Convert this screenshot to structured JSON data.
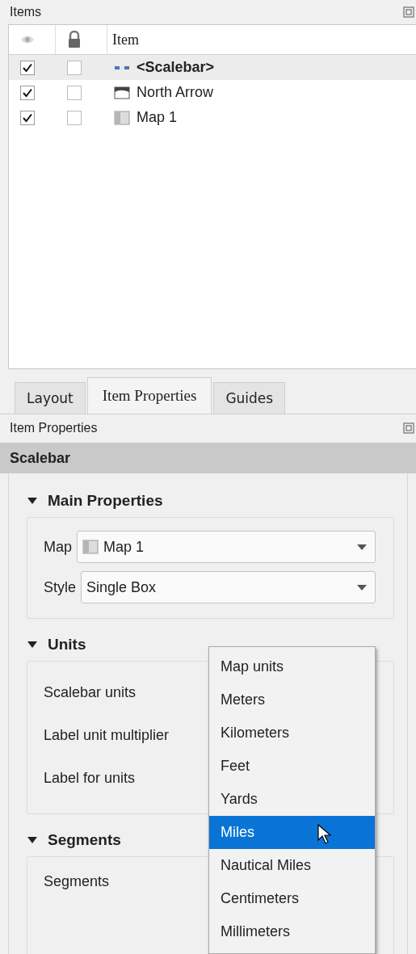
{
  "items_panel": {
    "title": "Items",
    "item_column": "Item",
    "rows": [
      {
        "label": "<Scalebar>",
        "kind": "scalebar",
        "visible": true,
        "locked": false,
        "selected": true
      },
      {
        "label": "North Arrow",
        "kind": "picture",
        "visible": true,
        "locked": false,
        "selected": false
      },
      {
        "label": "Map 1",
        "kind": "map",
        "visible": true,
        "locked": false,
        "selected": false
      }
    ]
  },
  "tabs": [
    {
      "label": "Layout",
      "selected": false
    },
    {
      "label": "Item Properties",
      "selected": true
    },
    {
      "label": "Guides",
      "selected": false
    }
  ],
  "properties_panel": {
    "title": "Item Properties",
    "item_header": "Scalebar",
    "groups": [
      {
        "title": "Main Properties",
        "expanded": true,
        "rows": [
          {
            "label": "Map",
            "kind": "map_combo",
            "value": "Map 1"
          },
          {
            "label": "Style",
            "kind": "combo",
            "value": "Single Box"
          }
        ]
      },
      {
        "title": "Units",
        "expanded": true,
        "rows": [
          {
            "label": "Scalebar units",
            "kind": "label"
          },
          {
            "label": "Label unit multiplier",
            "kind": "label"
          },
          {
            "label": "Label for units",
            "kind": "label"
          }
        ]
      },
      {
        "title": "Segments",
        "expanded": true,
        "rows": [
          {
            "label": "Segments",
            "kind": "label"
          }
        ]
      }
    ]
  },
  "units_dropdown": {
    "options": [
      {
        "label": "Map units",
        "selected": false
      },
      {
        "label": "Meters",
        "selected": false
      },
      {
        "label": "Kilometers",
        "selected": false
      },
      {
        "label": "Feet",
        "selected": false
      },
      {
        "label": "Yards",
        "selected": false
      },
      {
        "label": "Miles",
        "selected": true
      },
      {
        "label": "Nautical Miles",
        "selected": false
      },
      {
        "label": "Centimeters",
        "selected": false
      },
      {
        "label": "Millimeters",
        "selected": false
      }
    ]
  }
}
